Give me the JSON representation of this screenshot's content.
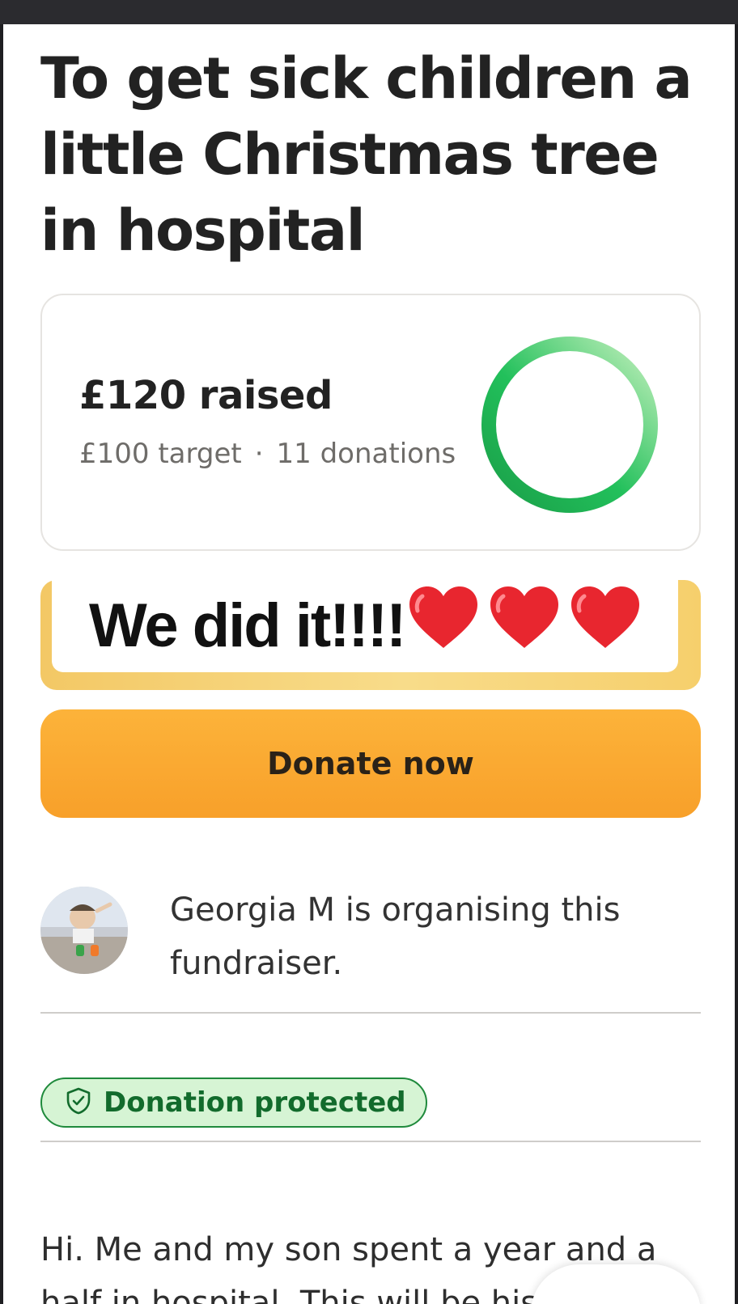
{
  "fundraiser": {
    "title": "To get sick children a little Christmas tree in hospital",
    "raised_text": "£120 raised",
    "target_text": "£100 target",
    "separator": "·",
    "donations_text": "11 donations",
    "progress_fraction": 1.0
  },
  "update": {
    "text": "We did it!!!!",
    "hearts": [
      "❤️",
      "❤️",
      "❤️"
    ]
  },
  "actions": {
    "donate_label": "Donate now"
  },
  "organiser": {
    "text": "Georgia M is organising this fundraiser."
  },
  "badge": {
    "label": "Donation protected"
  },
  "story": {
    "text": "Hi. Me and my son spent a year and a half in hospital. This will be his fi..."
  },
  "colors": {
    "brand_green": "#1f8a3c",
    "donate_orange": "#f8a02a",
    "ring_start": "#1cae52",
    "ring_end": "#b5ecb0"
  },
  "icons": {
    "badge_icon": "shield-check-icon"
  }
}
